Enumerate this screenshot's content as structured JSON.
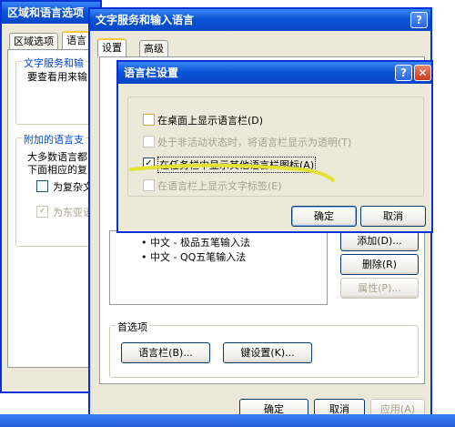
{
  "back_window": {
    "title": "区域和语言选项",
    "tabs": [
      "区域选项",
      "语言"
    ],
    "group1": {
      "title": "文字服务和输",
      "desc": "要查看用来输"
    },
    "group2": {
      "title": "附加的语言支",
      "desc_line1": "大多数语言都",
      "desc_line2": "下面相应的复",
      "checkbox1": "为复杂文",
      "checkbox2": "为东亚语"
    }
  },
  "mid_window": {
    "title": "文字服务和输入语言",
    "tabs": [
      "设置",
      "高级"
    ],
    "input_methods": [
      "中文 - 极品五笔输入法",
      "中文 - QQ五笔输入法"
    ],
    "buttons": {
      "add": "添加(D)...",
      "remove": "删除(R)",
      "properties": "属性(P)..."
    },
    "prefs": {
      "title": "首选项",
      "langbar_button": "语言栏(B)...",
      "keysettings_button": "键设置(K)..."
    },
    "footer": {
      "ok": "确定",
      "cancel": "取消",
      "apply": "应用(A)"
    }
  },
  "dialog": {
    "title": "语言栏设置",
    "options": [
      {
        "label": "在桌面上显示语言栏(D)",
        "checked": false,
        "disabled": false
      },
      {
        "label": "处于非活动状态时，将语言栏显示为透明(T)",
        "checked": false,
        "disabled": true
      },
      {
        "label": "在任务栏中显示其他语言栏图标(A)",
        "checked": true,
        "disabled": false
      },
      {
        "label": "在语言栏上显示文字标签(E)",
        "checked": false,
        "disabled": true
      }
    ],
    "ok": "确定",
    "cancel": "取消"
  },
  "titlebar_icons": {
    "help": "?",
    "close": "✕"
  },
  "colors": {
    "xp_blue": "#0831d9",
    "highlight_stroke": "#e6e233",
    "disabled_text": "#a7a08b"
  }
}
